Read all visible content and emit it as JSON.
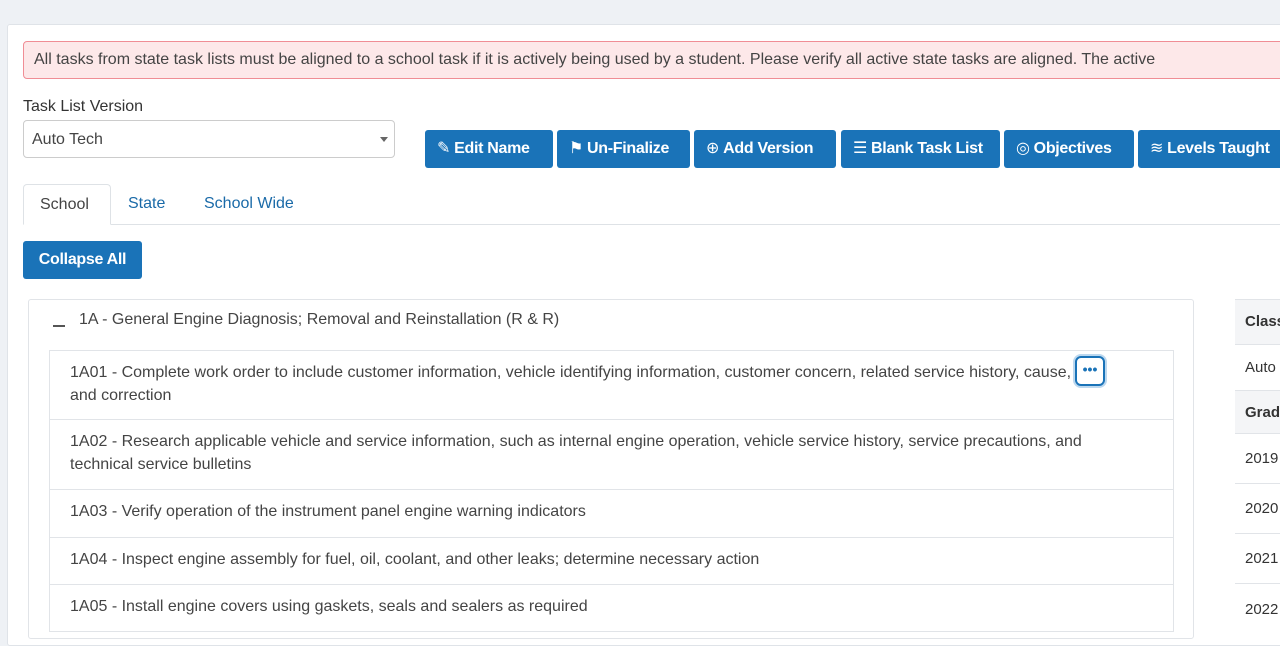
{
  "alert": {
    "text": "All tasks from state task lists must be aligned to a school task if it is actively being used by a student. Please verify all active state tasks are aligned. The active"
  },
  "task_list_version": {
    "label": "Task List Version",
    "selected": "Auto Tech"
  },
  "toolbar": {
    "buttons": [
      {
        "label": "Edit Name",
        "icon": "pencil-icon",
        "glyph": "✎"
      },
      {
        "label": "Un-Finalize",
        "icon": "flag-icon",
        "glyph": "⚑"
      },
      {
        "label": "Add Version",
        "icon": "plus-circle-icon",
        "glyph": "⊕"
      },
      {
        "label": "Blank Task List",
        "icon": "list-icon",
        "glyph": "☰"
      },
      {
        "label": "Objectives",
        "icon": "target-icon",
        "glyph": "◎"
      },
      {
        "label": "Levels Taught",
        "icon": "layers-icon",
        "glyph": "≋"
      }
    ]
  },
  "tabs": [
    {
      "label": "School",
      "active": true
    },
    {
      "label": "State",
      "active": false
    },
    {
      "label": "School Wide",
      "active": false
    }
  ],
  "collapse_all_label": "Collapse All",
  "section": {
    "title": "1A - General Engine Diagnosis; Removal and Reinstallation (R & R)",
    "tasks": [
      {
        "text": "1A01 - Complete work order to include customer information, vehicle identifying information, customer concern, related service history, cause, and correction"
      },
      {
        "text": "1A02 - Research applicable vehicle and service information, such as internal engine operation, vehicle service history, service precautions, and technical service bulletins"
      },
      {
        "text": "1A03 - Verify operation of the instrument panel engine warning indicators"
      },
      {
        "text": "1A04 - Inspect engine assembly for fuel, oil, coolant, and other leaks; determine necessary action"
      },
      {
        "text": "1A05 - Install engine covers using gaskets, seals and sealers as required"
      }
    ],
    "more_glyph": "•••"
  },
  "side_table": {
    "rows": [
      "Class",
      "Auto",
      "Grad",
      "2019",
      "2020",
      "2021",
      "2022"
    ]
  },
  "colors": {
    "primary": "#1a73b8",
    "alert_bg": "#fde8e9",
    "alert_border": "#f08d95"
  }
}
